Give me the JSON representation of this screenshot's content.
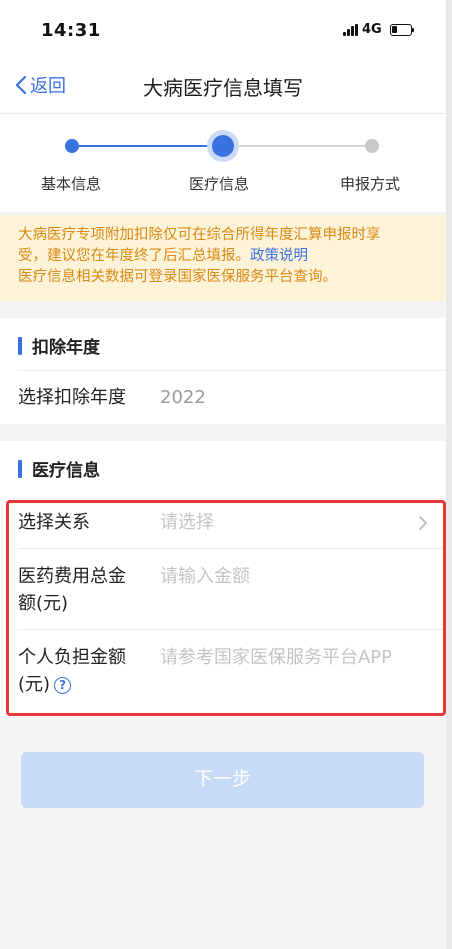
{
  "status_bar": {
    "time": "14:31",
    "network": "4G"
  },
  "nav": {
    "back_label": "返回",
    "title": "大病医疗信息填写"
  },
  "steps": [
    {
      "label": "基本信息",
      "state": "done"
    },
    {
      "label": "医疗信息",
      "state": "current"
    },
    {
      "label": "申报方式",
      "state": "todo"
    }
  ],
  "notice": {
    "text_line1": "大病医疗专项附加扣除仅可在综合所得年度汇算申报时享",
    "text_line2": "受，建议您在年度终了后汇总填报。",
    "link": "政策说明",
    "text_line3": "医疗信息相关数据可登录国家医保服务平台查询。"
  },
  "deduction_year": {
    "section_title": "扣除年度",
    "label": "选择扣除年度",
    "value": "2022"
  },
  "medical_info": {
    "section_title": "医疗信息",
    "relation_label": "选择关系",
    "relation_placeholder": "请选择",
    "total_label_1": "医药费用总金",
    "total_label_2": "额(元)",
    "total_placeholder": "请输入金额",
    "personal_label_1": "个人负担金额",
    "personal_label_2": "(元)",
    "personal_placeholder": "请参考国家医保服务平台APP",
    "help_glyph": "?"
  },
  "next_button": "下一步",
  "colors": {
    "accent": "#3a72e0",
    "notice_bg": "#fdf3d9",
    "notice_text": "#d98a14",
    "highlight": "#e53935",
    "button_disabled": "#c7dbf8"
  }
}
